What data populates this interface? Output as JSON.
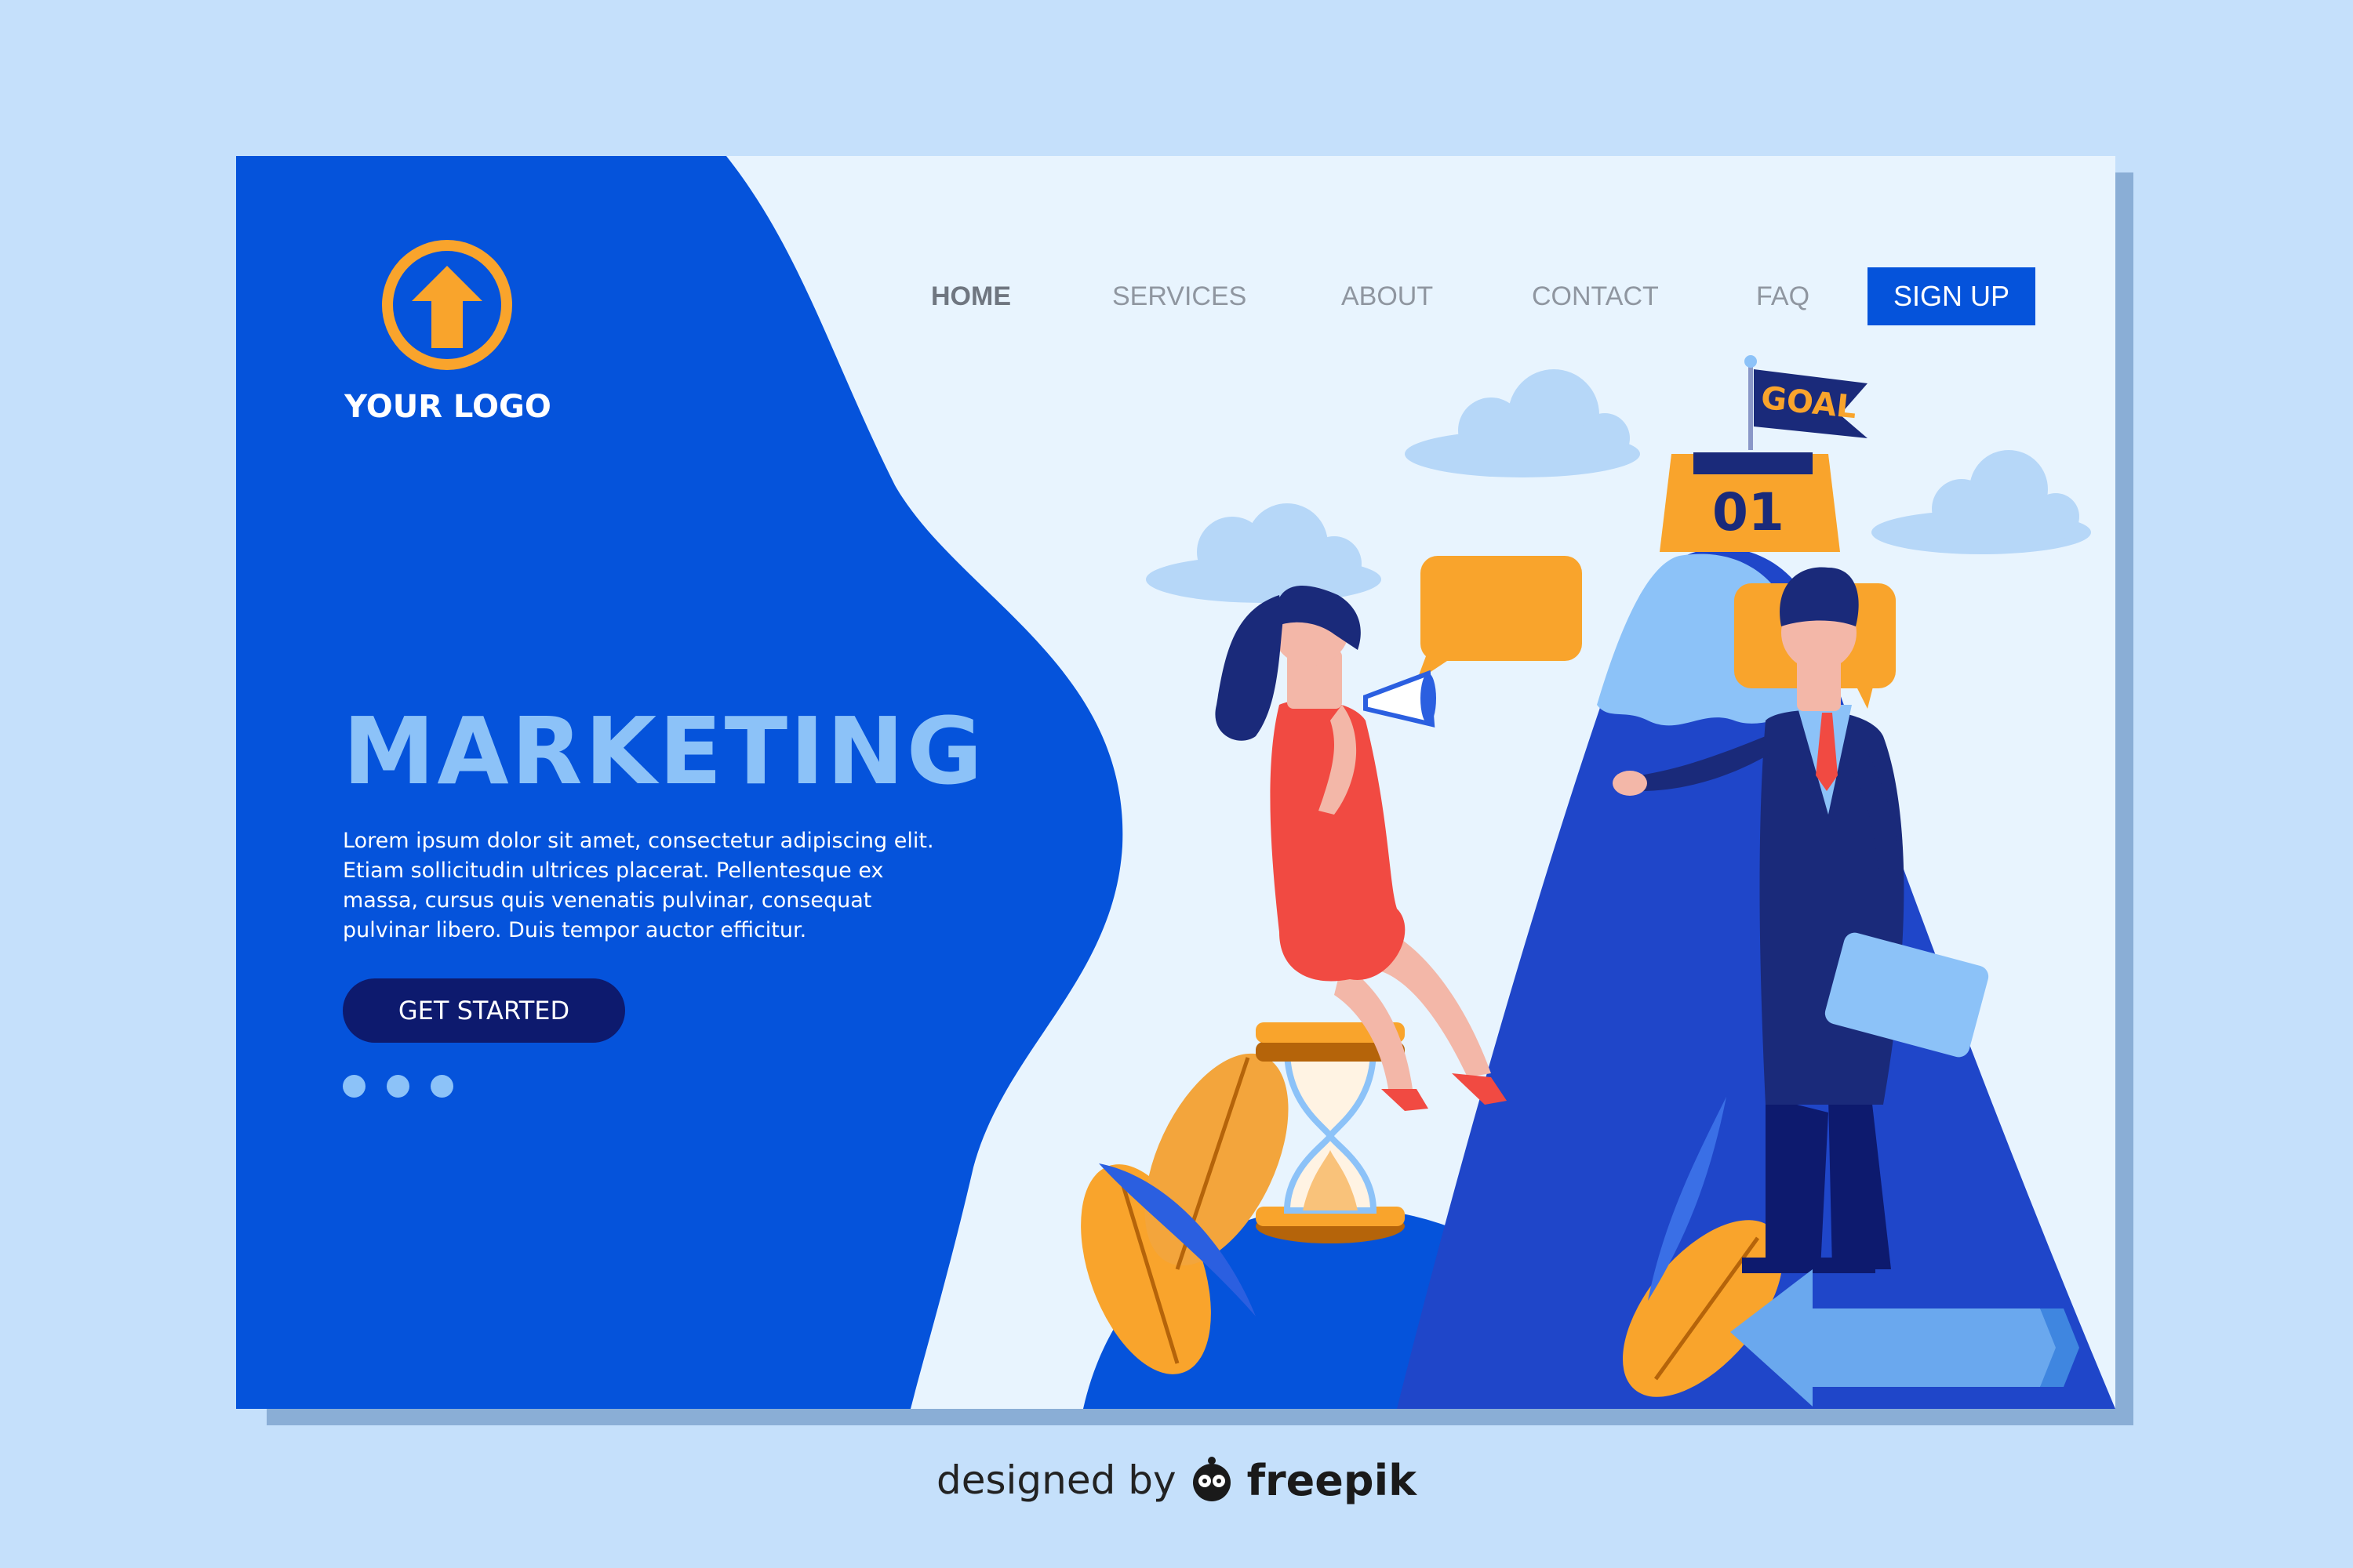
{
  "logo": {
    "text": "YOUR LOGO",
    "icon": "up-arrow-circle-icon"
  },
  "nav": {
    "items": [
      {
        "label": "HOME",
        "active": true
      },
      {
        "label": "SERVICES",
        "active": false
      },
      {
        "label": "ABOUT",
        "active": false
      },
      {
        "label": "CONTACT",
        "active": false
      },
      {
        "label": "FAQ",
        "active": false
      }
    ],
    "signup_label": "SIGN UP"
  },
  "hero": {
    "title": "MARKETING",
    "body": "Lorem ipsum dolor sit amet, consectetur adipiscing elit. Etiam sollicitudin ultrices placerat. Pellentesque ex massa, cursus quis venenatis pulvinar, consequat pulvinar libero. Duis tempor auctor efficitur.",
    "cta_label": "GET STARTED",
    "carousel_dots": 3
  },
  "illustration": {
    "flag_text": "GOAL",
    "calendar_text": "01"
  },
  "footer": {
    "designed_by": "designed by",
    "brand": "freepik"
  },
  "colors": {
    "page_bg": "#c5e0fb",
    "primary_blue": "#0553db",
    "light_blue": "#8cc2f8",
    "navy": "#0d1a6e",
    "orange": "#f9a42c",
    "card_bg": "#e8f4fe"
  }
}
